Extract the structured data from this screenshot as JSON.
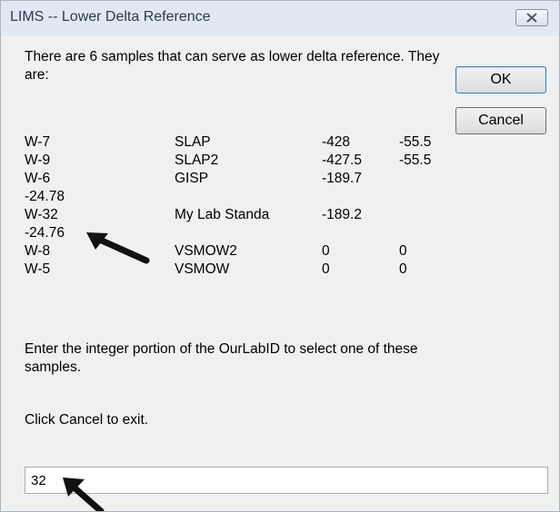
{
  "window": {
    "title": "LIMS -- Lower Delta Reference"
  },
  "message": {
    "intro": "There are 6 samples that can serve as lower delta reference. They are:",
    "instructions": "Enter the integer portion of the OurLabID to select one of these samples.",
    "cancel_note": "Click Cancel to exit."
  },
  "samples": [
    {
      "id": "W-7",
      "name": "SLAP",
      "d1": "-428",
      "d2": "-55.5"
    },
    {
      "id": "W-9",
      "name": "SLAP2",
      "d1": "-427.5",
      "d2": "-55.5"
    },
    {
      "id": "W-6",
      "name": "GISP",
      "d1": "-189.7",
      "d2": ""
    },
    {
      "id": "-24.78",
      "name": "",
      "d1": "",
      "d2": ""
    },
    {
      "id": "W-32",
      "name": "My Lab Standa",
      "d1": "-189.2",
      "d2": ""
    },
    {
      "id": "-24.76",
      "name": "",
      "d1": "",
      "d2": ""
    },
    {
      "id": "W-8",
      "name": "VSMOW2",
      "d1": "0",
      "d2": "0"
    },
    {
      "id": "W-5",
      "name": "VSMOW",
      "d1": "0",
      "d2": "0"
    }
  ],
  "buttons": {
    "ok": "OK",
    "cancel": "Cancel"
  },
  "input": {
    "value": "32"
  },
  "icons": {
    "close": "close-icon",
    "annotation": "arrow-icon"
  },
  "colors": {
    "titlebar": "#dfe8f3",
    "dialog_bg": "#f0f0f0",
    "arrow": "#111111"
  }
}
